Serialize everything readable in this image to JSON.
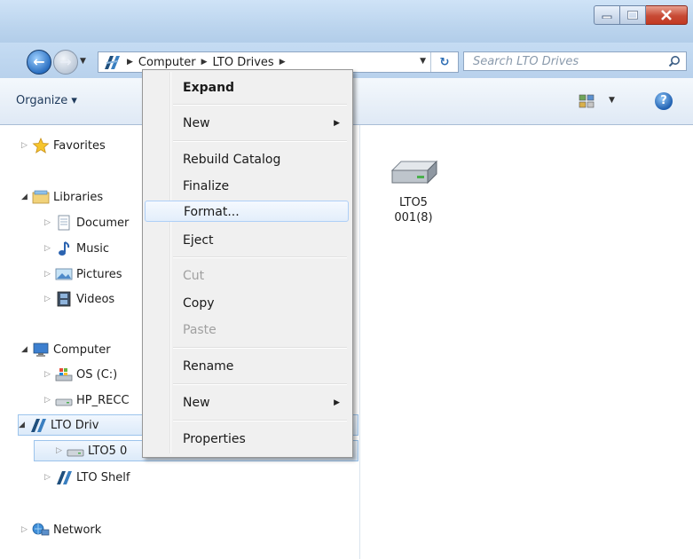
{
  "window": {
    "controls": {
      "minimize_icon": "minimize-icon",
      "maximize_icon": "maximize-icon",
      "close_icon": "close-icon"
    }
  },
  "address": {
    "crumbs": [
      "Computer",
      "LTO Drives"
    ],
    "search_placeholder": "Search LTO Drives"
  },
  "toolbar": {
    "organize_label": "Organize ▾"
  },
  "nav": {
    "favorites": "Favorites",
    "libraries": "Libraries",
    "documents": "Documer",
    "music": "Music",
    "pictures": "Pictures",
    "videos": "Videos",
    "computer": "Computer",
    "os": "OS (C:)",
    "hp_recovery": "HP_RECC",
    "lto_drives": "LTO Driv",
    "lto5": "LTO5 0",
    "lto_shelf": "LTO Shelf",
    "network": "Network"
  },
  "content": {
    "drive_label_line1": "LTO5",
    "drive_label_line2": "001(8)"
  },
  "context_menu": {
    "expand": "Expand",
    "new1": "New",
    "rebuild": "Rebuild Catalog",
    "finalize": "Finalize",
    "format": "Format...",
    "eject": "Eject",
    "cut": "Cut",
    "copy": "Copy",
    "paste": "Paste",
    "rename": "Rename",
    "new2": "New",
    "properties": "Properties"
  },
  "colors": {
    "accent": "#2a6fc1",
    "selection_border": "#9cc4ec",
    "menu_bg": "#f0f0f0"
  }
}
